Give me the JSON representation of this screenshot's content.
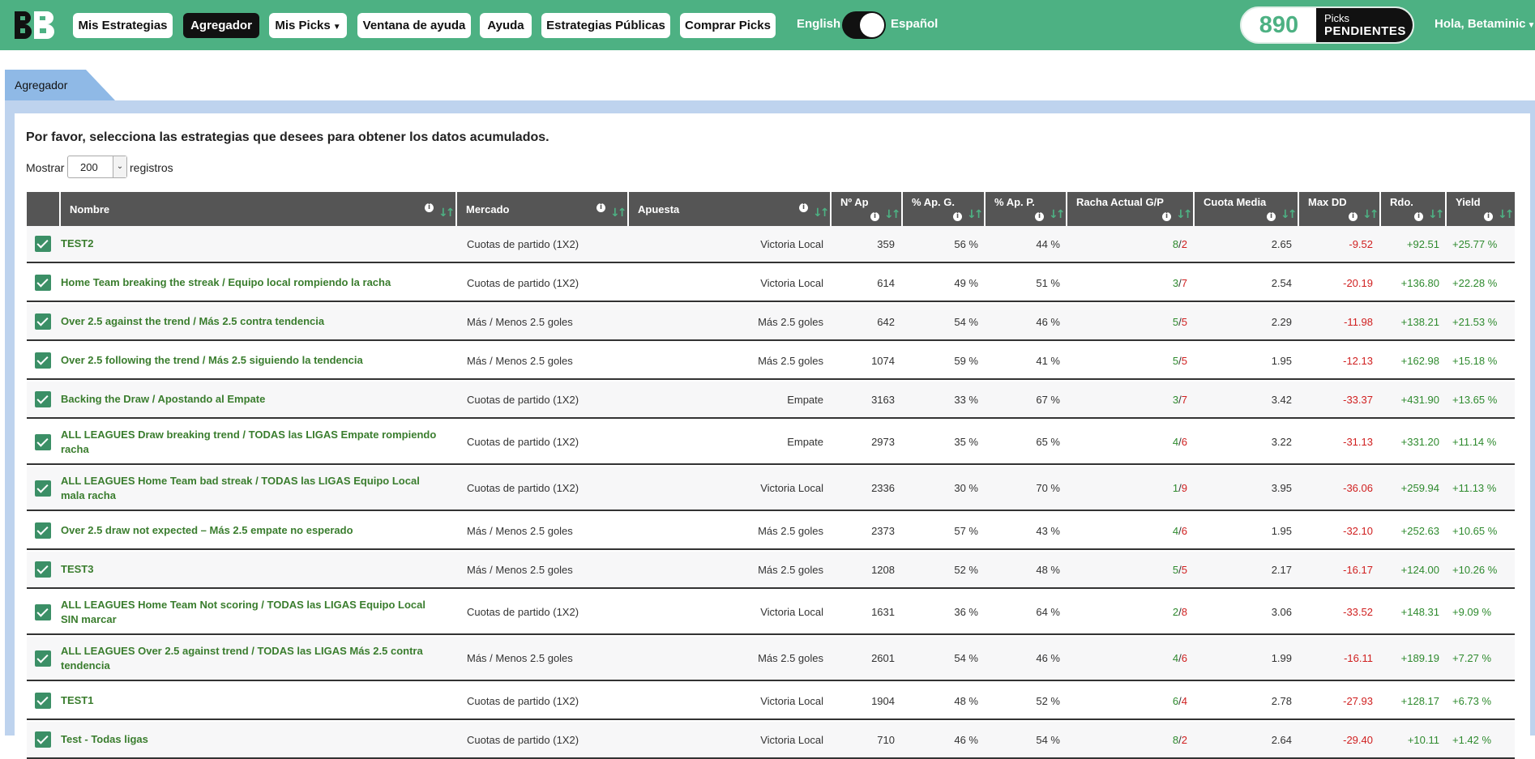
{
  "brand": {
    "logo_text": "BB",
    "logo_icon": "bb-logo-icon",
    "accent": "#4db183"
  },
  "nav": {
    "items": [
      {
        "label": "Mis Estrategias"
      },
      {
        "label": "Agregador",
        "active": true
      },
      {
        "label": "Mis Picks",
        "dropdown": true
      },
      {
        "label": "Ventana de ayuda"
      },
      {
        "label": "Ayuda"
      },
      {
        "label": "Estrategias Públicas"
      },
      {
        "label": "Comprar Picks"
      }
    ],
    "lang_left": "English",
    "lang_right": "Español",
    "lang_selected": "Español",
    "picks_count": "890",
    "picks_label_top": "Picks",
    "picks_label_bottom": "PENDIENTES",
    "greeting": "Hola, Betaminic"
  },
  "tab": {
    "label": "Agregador"
  },
  "main": {
    "intro": "Por favor, selecciona las estrategias que desees para obtener los datos acumulados.",
    "show_label": "Mostrar",
    "show_value": "200",
    "records_label": "registros"
  },
  "table": {
    "columns": [
      {
        "label": ""
      },
      {
        "label": "Nombre",
        "info": true,
        "sort": true
      },
      {
        "label": "Mercado",
        "info": true,
        "sort": true
      },
      {
        "label": "Apuesta",
        "info": true,
        "sort": true
      },
      {
        "label": "Nº Ap",
        "info": true,
        "sort": true
      },
      {
        "label": "% Ap. G.",
        "info": true,
        "sort": true
      },
      {
        "label": "% Ap. P.",
        "info": true,
        "sort": true
      },
      {
        "label": "Racha Actual G/P",
        "info": true,
        "sort": true
      },
      {
        "label": "Cuota Media",
        "info": true,
        "sort": true
      },
      {
        "label": "Max DD",
        "info": true,
        "sort": true
      },
      {
        "label": "Rdo.",
        "info": true,
        "sort": true
      },
      {
        "label": "Yield",
        "info": true,
        "sort": true
      }
    ],
    "rows": [
      {
        "checked": true,
        "nombre": "TEST2",
        "mercado": "Cuotas de partido (1X2)",
        "apuesta": "Victoria Local",
        "nap": "359",
        "pg": "56 %",
        "pp": "44 %",
        "racha_g": "8",
        "racha_p": "2",
        "cuota": "2.65",
        "maxdd": "-9.52",
        "rdo": "+92.51",
        "yield": "+25.77 %"
      },
      {
        "checked": true,
        "nombre": "Home Team breaking the streak / Equipo local rompiendo la racha",
        "mercado": "Cuotas de partido (1X2)",
        "apuesta": "Victoria Local",
        "nap": "614",
        "pg": "49 %",
        "pp": "51 %",
        "racha_g": "3",
        "racha_p": "7",
        "cuota": "2.54",
        "maxdd": "-20.19",
        "rdo": "+136.80",
        "yield": "+22.28 %"
      },
      {
        "checked": true,
        "nombre": "Over 2.5 against the trend / Más 2.5 contra tendencia",
        "mercado": "Más / Menos 2.5 goles",
        "apuesta": "Más 2.5 goles",
        "nap": "642",
        "pg": "54 %",
        "pp": "46 %",
        "racha_g": "5",
        "racha_p": "5",
        "cuota": "2.29",
        "maxdd": "-11.98",
        "rdo": "+138.21",
        "yield": "+21.53 %"
      },
      {
        "checked": true,
        "nombre": "Over 2.5 following the trend / Más 2.5 siguiendo la tendencia",
        "mercado": "Más / Menos 2.5 goles",
        "apuesta": "Más 2.5 goles",
        "nap": "1074",
        "pg": "59 %",
        "pp": "41 %",
        "racha_g": "5",
        "racha_p": "5",
        "cuota": "1.95",
        "maxdd": "-12.13",
        "rdo": "+162.98",
        "yield": "+15.18 %"
      },
      {
        "checked": true,
        "nombre": "Backing the Draw / Apostando al Empate",
        "mercado": "Cuotas de partido (1X2)",
        "apuesta": "Empate",
        "nap": "3163",
        "pg": "33 %",
        "pp": "67 %",
        "racha_g": "3",
        "racha_p": "7",
        "cuota": "3.42",
        "maxdd": "-33.37",
        "rdo": "+431.90",
        "yield": "+13.65 %"
      },
      {
        "checked": true,
        "nombre": "ALL LEAGUES Draw breaking trend / TODAS las LIGAS Empate rompiendo racha",
        "mercado": "Cuotas de partido (1X2)",
        "apuesta": "Empate",
        "nap": "2973",
        "pg": "35 %",
        "pp": "65 %",
        "racha_g": "4",
        "racha_p": "6",
        "cuota": "3.22",
        "maxdd": "-31.13",
        "rdo": "+331.20",
        "yield": "+11.14 %"
      },
      {
        "checked": true,
        "nombre": "ALL LEAGUES Home Team bad streak / TODAS las LIGAS Equipo Local mala racha",
        "mercado": "Cuotas de partido (1X2)",
        "apuesta": "Victoria Local",
        "nap": "2336",
        "pg": "30 %",
        "pp": "70 %",
        "racha_g": "1",
        "racha_p": "9",
        "cuota": "3.95",
        "maxdd": "-36.06",
        "rdo": "+259.94",
        "yield": "+11.13 %"
      },
      {
        "checked": true,
        "nombre": "Over 2.5 draw not expected – Más 2.5 empate no esperado",
        "mercado": "Más / Menos 2.5 goles",
        "apuesta": "Más 2.5 goles",
        "nap": "2373",
        "pg": "57 %",
        "pp": "43 %",
        "racha_g": "4",
        "racha_p": "6",
        "cuota": "1.95",
        "maxdd": "-32.10",
        "rdo": "+252.63",
        "yield": "+10.65 %"
      },
      {
        "checked": true,
        "nombre": "TEST3",
        "mercado": "Más / Menos 2.5 goles",
        "apuesta": "Más 2.5 goles",
        "nap": "1208",
        "pg": "52 %",
        "pp": "48 %",
        "racha_g": "5",
        "racha_p": "5",
        "cuota": "2.17",
        "maxdd": "-16.17",
        "rdo": "+124.00",
        "yield": "+10.26 %"
      },
      {
        "checked": true,
        "nombre": "ALL LEAGUES Home Team Not scoring / TODAS las LIGAS Equipo Local SIN marcar",
        "mercado": "Cuotas de partido (1X2)",
        "apuesta": "Victoria Local",
        "nap": "1631",
        "pg": "36 %",
        "pp": "64 %",
        "racha_g": "2",
        "racha_p": "8",
        "cuota": "3.06",
        "maxdd": "-33.52",
        "rdo": "+148.31",
        "yield": "+9.09 %"
      },
      {
        "checked": true,
        "nombre": "ALL LEAGUES Over 2.5 against trend / TODAS las LIGAS Más 2.5 contra tendencia",
        "mercado": "Más / Menos 2.5 goles",
        "apuesta": "Más 2.5 goles",
        "nap": "2601",
        "pg": "54 %",
        "pp": "46 %",
        "racha_g": "4",
        "racha_p": "6",
        "cuota": "1.99",
        "maxdd": "-16.11",
        "rdo": "+189.19",
        "yield": "+7.27 %"
      },
      {
        "checked": true,
        "nombre": "TEST1",
        "mercado": "Cuotas de partido (1X2)",
        "apuesta": "Victoria Local",
        "nap": "1904",
        "pg": "48 %",
        "pp": "52 %",
        "racha_g": "6",
        "racha_p": "4",
        "cuota": "2.78",
        "maxdd": "-27.93",
        "rdo": "+128.17",
        "yield": "+6.73 %"
      },
      {
        "checked": true,
        "nombre": "Test - Todas ligas",
        "mercado": "Cuotas de partido (1X2)",
        "apuesta": "Victoria Local",
        "nap": "710",
        "pg": "46 %",
        "pp": "54 %",
        "racha_g": "8",
        "racha_p": "2",
        "cuota": "2.64",
        "maxdd": "-29.40",
        "rdo": "+10.11",
        "yield": "+1.42 %"
      }
    ],
    "colors": {
      "positive": "#2e8a2e",
      "negative": "#d01f1f",
      "header_bg": "#555555",
      "sort_icon": "#4db183"
    }
  }
}
